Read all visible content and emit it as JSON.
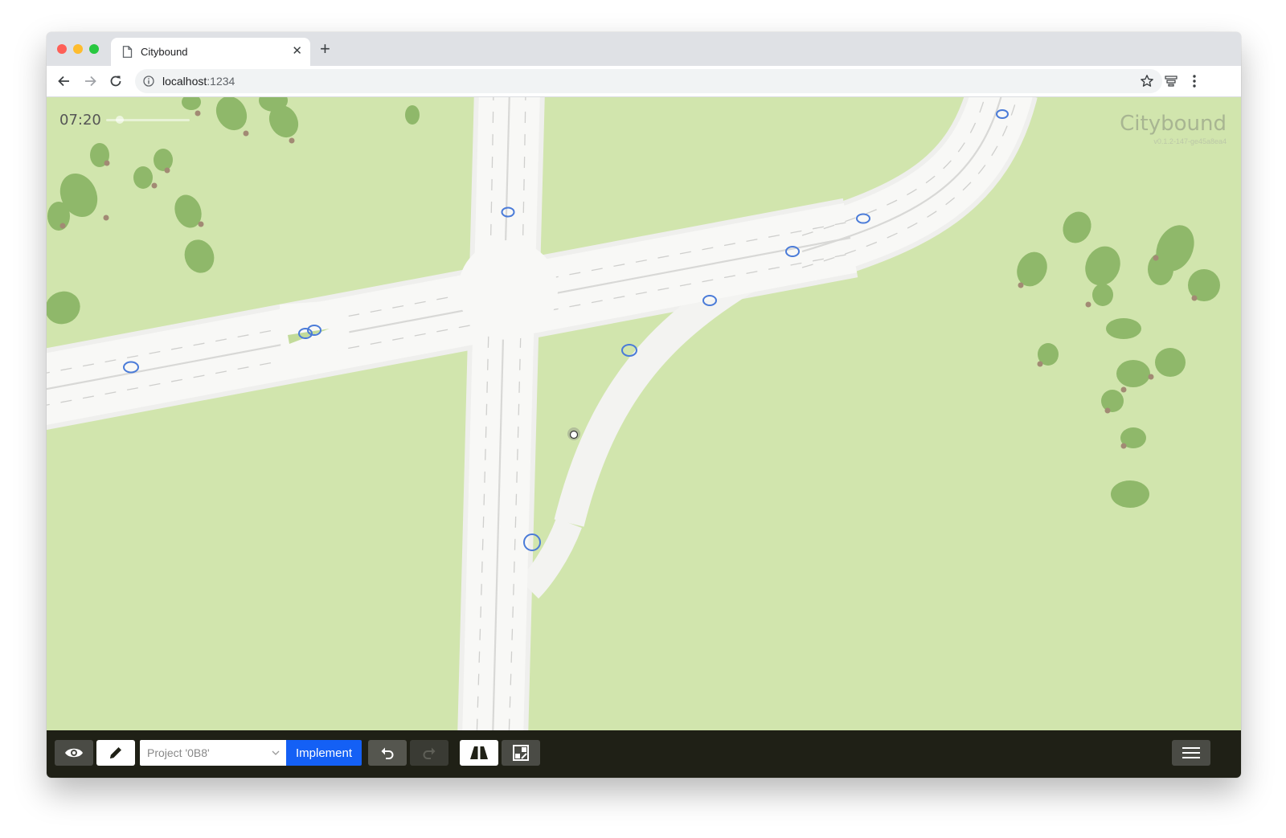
{
  "browser": {
    "tab_title": "Citybound",
    "url_host": "localhost",
    "url_port": ":1234"
  },
  "game": {
    "clock": "07:20",
    "brand": "Citybound",
    "version": "v0.1.2-147-ge45a8ea4"
  },
  "bottom_bar": {
    "project_value": "Project '0B8'",
    "implement_label": "Implement"
  },
  "icons": {
    "view": "eye-icon",
    "edit": "pencil-icon",
    "undo": "undo-icon",
    "redo": "redo-icon",
    "roads": "road-icon",
    "zones": "zoning-icon",
    "menu": "hamburger-menu-icon"
  },
  "colors": {
    "grass": "#d1e5ad",
    "road": "#f7f7f5",
    "tree": "#8fb86a",
    "lane_marker": "#4a7bd8",
    "implement_button": "#1460f5",
    "bottom_bar": "#1f2016"
  }
}
